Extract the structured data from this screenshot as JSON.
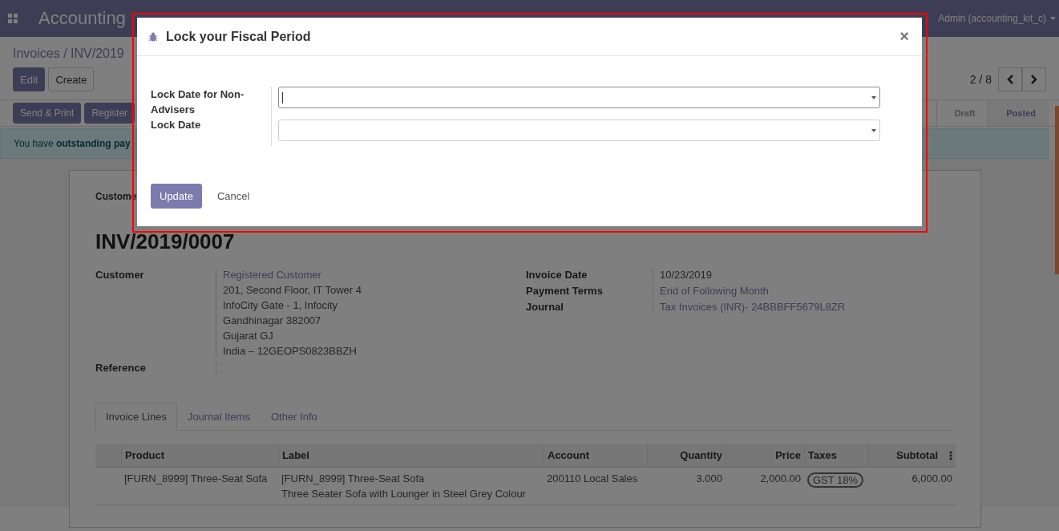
{
  "navbar": {
    "app_name": "Accounting",
    "user": "Admin (accounting_kit_c)"
  },
  "breadcrumb": "Invoices / INV/2019",
  "actions": [
    "Edit",
    "Create"
  ],
  "pager": "2 / 8",
  "buttons": [
    "Send & Print",
    "Register"
  ],
  "statusbar": [
    {
      "label": "Draft",
      "selected": false
    },
    {
      "label": "Posted",
      "selected": true
    }
  ],
  "alert": "You have **outstanding pay**",
  "sheet": {
    "subtitle": "Custome",
    "title": "INV/2019/0007",
    "left_fields": [
      {
        "label": "Customer",
        "link": "Registered Customer",
        "lines": [
          "201, Second Floor, IT Tower 4",
          "InfoCity Gate - 1, Infocity",
          "Gandhinagar 382007",
          "Gujarat GJ",
          "India – 12GEOPS0823BBZH"
        ]
      },
      {
        "label": "Reference"
      }
    ],
    "right_fields": [
      {
        "label": "Invoice Date",
        "value": "10/23/2019",
        "kind": "text"
      },
      {
        "label": "Payment Terms",
        "value": "End of Following Month",
        "kind": "link"
      },
      {
        "label": "Journal",
        "value": "Tax Invoices (INR)- 24BBBFF5679L8ZR",
        "kind": "link"
      }
    ]
  },
  "tabs": [
    {
      "label": "Invoice Lines",
      "selected": true
    },
    {
      "label": "Journal Items",
      "selected": false
    },
    {
      "label": "Other Info",
      "selected": false
    }
  ],
  "table": {
    "columns": [
      "Product",
      "Label",
      "Account",
      "Quantity",
      "Price",
      "Taxes",
      "Subtotal"
    ],
    "rows": [
      {
        "product": "[FURN_8999] Three-Seat Sofa",
        "label": [
          "[FURN_8999] Three-Seat Sofa",
          "Three Seater Sofa with Lounger in Steel Grey Colour"
        ],
        "account": "200110 Local Sales",
        "quantity": "3.000",
        "price": "2,000.00",
        "taxes": [
          "GST 18%"
        ],
        "subtotal": "6,000.00"
      }
    ]
  },
  "dialog": {
    "title": "Lock your Fiscal Period",
    "close": "×",
    "fields": [
      {
        "label": "Lock Date for Non-Advisers",
        "focused": true
      },
      {
        "label": "Lock Date",
        "focused": false
      }
    ],
    "buttons": [
      {
        "label": "Update",
        "kind": "primary"
      },
      {
        "label": "Cancel",
        "kind": "link"
      }
    ]
  }
}
